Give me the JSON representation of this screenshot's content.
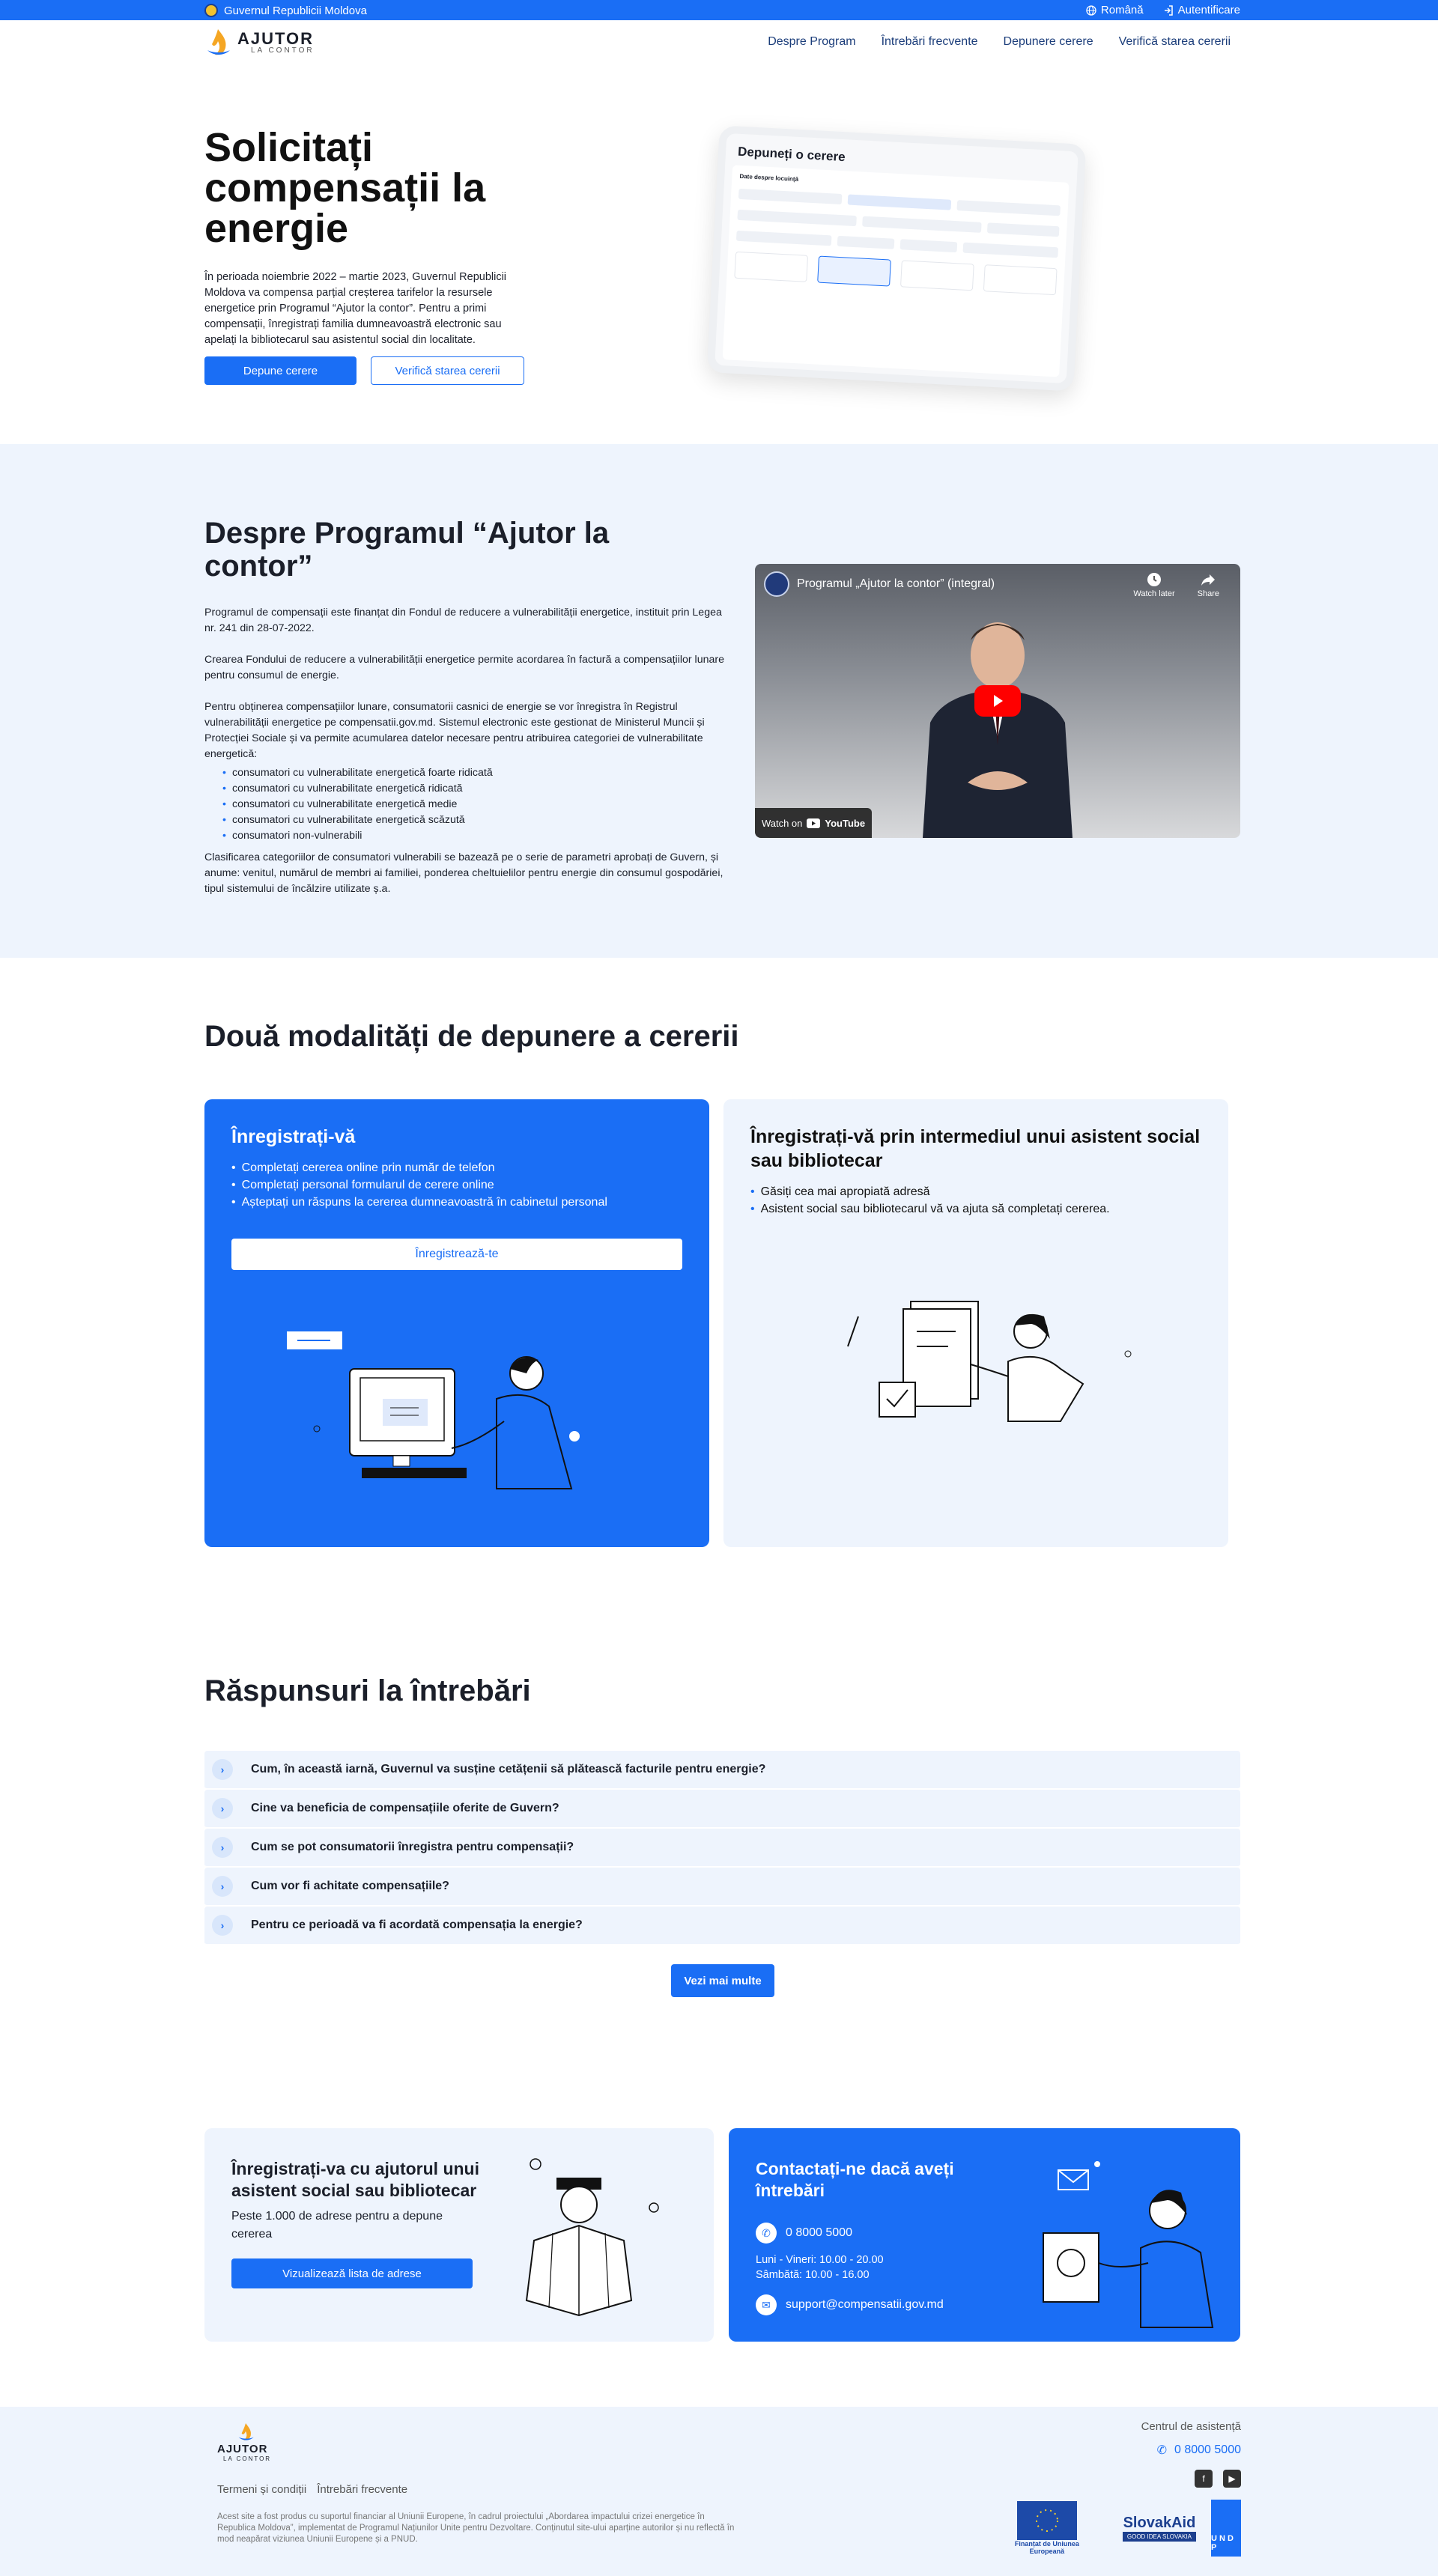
{
  "topbar": {
    "gov": "Guvernul Republicii Moldova",
    "language": "Română",
    "login": "Autentificare"
  },
  "header": {
    "logo_name": "AJUTOR",
    "logo_sub": "LA CONTOR",
    "nav": [
      "Despre Program",
      "Întrebări frecvente",
      "Depunere cerere",
      "Verifică starea cererii"
    ]
  },
  "hero": {
    "title": "Solicitați compensații la energie",
    "text": "În perioada noiembrie 2022 – martie 2023, Guvernul Republicii Moldova va compensa parțial creșterea tarifelor la resursele energetice prin Programul “Ajutor la contor”. Pentru a primi compensații, înregistrați familia dumneavoastră electronic sau apelați la bibliotecarul sau asistentul social din localitate.",
    "btn_submit": "Depune cerere",
    "btn_check": "Verifică starea cererii",
    "tablet_title": "Depuneți o cerere",
    "tablet_sub": "Date despre locuință"
  },
  "about": {
    "title": "Despre Programul “Ajutor la contor”",
    "p1": "Programul de compensații este finanțat din Fondul de reducere a vulnerabilității energetice, instituit prin Legea nr. 241 din 28-07-2022.",
    "p2": "Crearea Fondului de reducere a vulnerabilității energetice permite acordarea în factură a compensațiilor lunare pentru consumul de energie.",
    "p3": "Pentru obținerea compensațiilor lunare, consumatorii casnici de energie se vor înregistra în Registrul vulnerabilității energetice pe compensatii.gov.md. Sistemul electronic este gestionat de Ministerul Muncii și Protecției Sociale și va permite acumularea datelor necesare pentru atribuirea categoriei de vulnerabilitate energetică:",
    "list": [
      "consumatori cu vulnerabilitate energetică foarte ridicată",
      "consumatori cu vulnerabilitate energetică ridicată",
      "consumatori cu vulnerabilitate energetică medie",
      "consumatori cu vulnerabilitate energetică scăzută",
      "consumatori non-vulnerabili"
    ],
    "p4": "Clasificarea categoriilor de consumatori vulnerabili se bazează pe o serie de parametri aprobați de Guvern, și anume: venitul, numărul de membri ai familiei, ponderea cheltuielilor pentru energie din consumul gospodăriei, tipul sistemului de încălzire utilizate ș.a.",
    "video_title": "Programul „Ajutor la contor” (integral)",
    "video_later": "Watch later",
    "video_share": "Share",
    "video_watch": "Watch on",
    "video_yt": "YouTube"
  },
  "ways": {
    "title": "Două modalități de depunere a cererii",
    "card1_title": "Înregistrați-vă",
    "card1_items": [
      "Completați cererea online prin număr de telefon",
      "Completați personal formularul de cerere online",
      "Așteptați un răspuns la cererea dumneavoastră în cabinetul personal"
    ],
    "card1_btn": "Înregistrează-te",
    "card2_title": "Înregistrați-vă prin intermediul unui asistent social sau bibliotecar",
    "card2_items": [
      "Găsiți cea mai apropiată adresă",
      "Asistent social sau bibliotecarul vă va ajuta să completați cererea."
    ]
  },
  "faq": {
    "title": "Răspunsuri la întrebări",
    "items": [
      "Cum, în această iarnă, Guvernul va susține cetățenii să plătească facturile pentru energie?",
      "Cine va beneficia de compensațiile oferite de Guvern?",
      "Cum se pot consumatorii înregistra pentru compensații?",
      "Cum vor fi achitate compensațiile?",
      "Pentru ce perioadă va fi acordată compensația la energie?"
    ],
    "more": "Vezi mai multe"
  },
  "help": {
    "title": "Înregistrați-va cu ajutorul unui asistent social sau bibliotecar",
    "text": "Peste 1.000 de adrese pentru a depune cererea",
    "btn": "Vizualizează lista de adrese"
  },
  "contact": {
    "title": "Contactați-ne dacă aveți întrebări",
    "phone": "0 8000 5000",
    "hours1": "Luni - Vineri: 10.00 - 20.00",
    "hours2": "Sâmbătă: 10.00 - 16.00",
    "email": "support@compensatii.gov.md"
  },
  "footer": {
    "link_terms": "Termeni și condiții",
    "link_faq": "Întrebări frecvente",
    "disclaimer": "Acest site a fost produs cu suportul financiar al Uniunii Europene, în cadrul proiectului „Abordarea impactului crizei energetice în Republica Moldova”, implementat de Programul Națiunilor Unite pentru Dezvoltare. Conținutul site-ului aparține autorilor și nu reflectă în mod neapărat viziunea Uniunii Europene și a PNUD.",
    "help_center": "Centrul de asistență",
    "phone": "0 8000 5000",
    "eu_label": "Finanțat de Uniunea Europeană",
    "slovak": "SlovakAid",
    "slovak_sub": "GOOD IDEA SLOVAKIA",
    "undp": "U N D P"
  },
  "colors": {
    "primary": "#1a6ef5",
    "light_bg": "#eef4fd"
  }
}
